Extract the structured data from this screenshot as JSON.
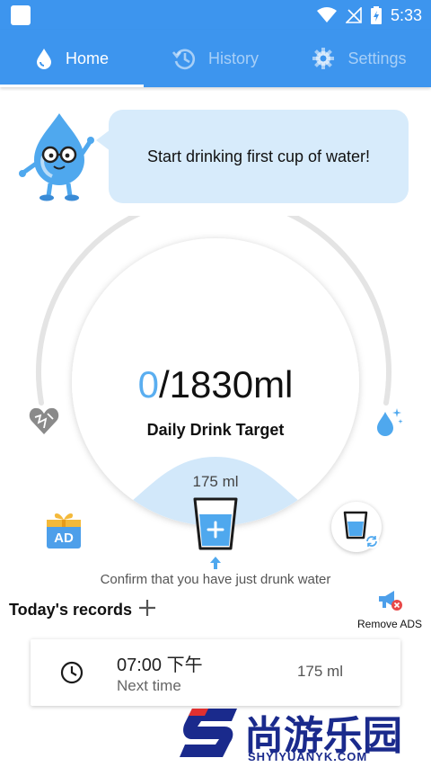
{
  "status_bar": {
    "time": "5:33"
  },
  "tabs": [
    {
      "label": "Home",
      "icon": "water-drop-icon",
      "active": true
    },
    {
      "label": "History",
      "icon": "history-icon",
      "active": false
    },
    {
      "label": "Settings",
      "icon": "gear-icon",
      "active": false
    }
  ],
  "tip": {
    "text": "Start drinking first cup of water!"
  },
  "drink": {
    "current": "0",
    "target": "/1830ml",
    "label": "Daily Drink Target",
    "cup_amount": "175 ml",
    "confirm_text": "Confirm that you have just drunk water"
  },
  "ad": {
    "label": "AD"
  },
  "records": {
    "title": "Today's records",
    "remove_ads_label": "Remove ADS",
    "items": [
      {
        "time": "07:00 下午",
        "subtitle": "Next time",
        "amount": "175 ml"
      }
    ]
  },
  "watermark": {
    "text": "尚游乐园",
    "url": "SHYIYUANYK.COM"
  },
  "colors": {
    "primary": "#3d95ee",
    "accent_light": "#d7ebfb",
    "progress_value": "#5aaef0",
    "watermark": "#1a2a8c"
  }
}
